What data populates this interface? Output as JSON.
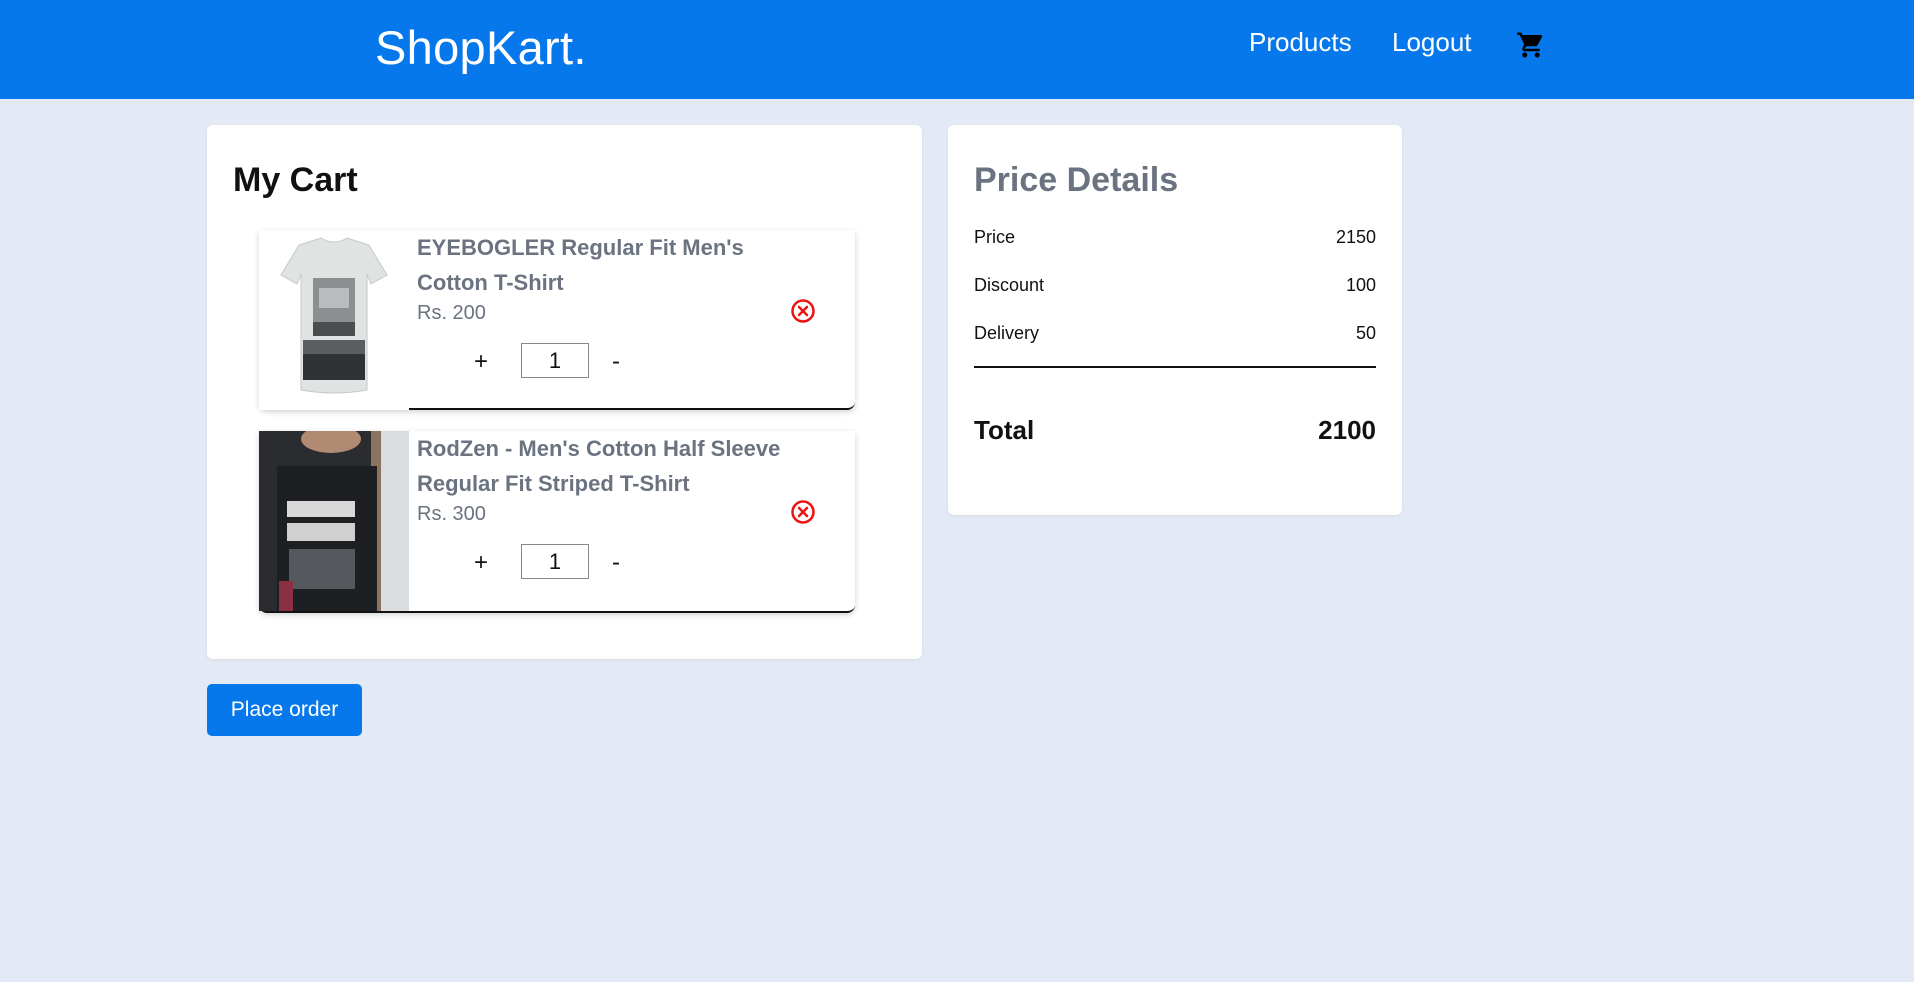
{
  "header": {
    "brand": "ShopKart.",
    "nav": {
      "products": "Products",
      "logout": "Logout"
    },
    "cart_icon": "shopping-cart-icon",
    "color": "#0778ec"
  },
  "cart": {
    "title": "My Cart",
    "items": [
      {
        "name": "EYEBOGLER Regular Fit Men's Cotton T-Shirt",
        "price": "Rs. 200",
        "quantity": "1",
        "plus": "+",
        "minus": "-",
        "image": "white-tshirt-image",
        "remove_icon": "remove-circle-x-icon"
      },
      {
        "name": "RodZen - Men's Cotton Half Sleeve Regular Fit Striped T-Shirt",
        "price": "Rs. 300",
        "quantity": "1",
        "plus": "+",
        "minus": "-",
        "image": "black-graphic-tshirt-image",
        "remove_icon": "remove-circle-x-icon"
      }
    ],
    "place_order": "Place order"
  },
  "price_details": {
    "title": "Price Details",
    "rows": [
      {
        "label": "Price",
        "value": "2150"
      },
      {
        "label": "Discount",
        "value": "100"
      },
      {
        "label": "Delivery",
        "value": "50"
      }
    ],
    "total": {
      "label": "Total",
      "value": "2100"
    }
  }
}
